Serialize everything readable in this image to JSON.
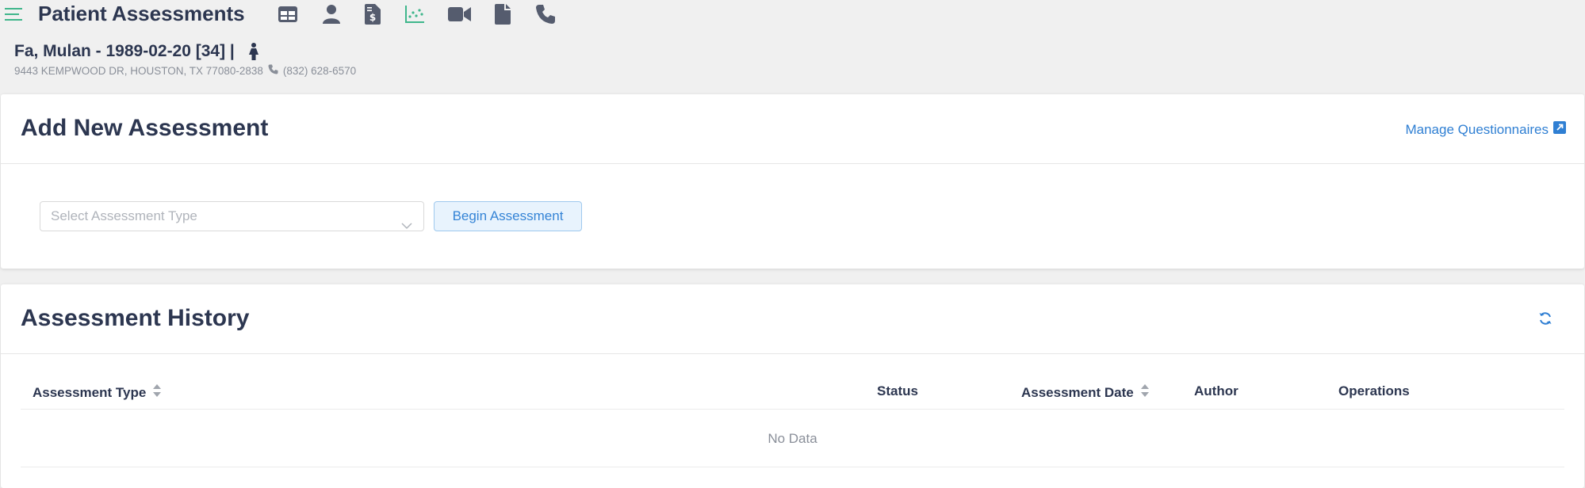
{
  "header": {
    "title": "Patient Assessments",
    "menu_icon": "hamburger-menu-icon",
    "nav_icons": [
      "table-icon",
      "person-icon",
      "billing-document-icon",
      "scatter-chart-icon",
      "video-icon",
      "file-icon",
      "phone-icon"
    ],
    "active_icon_color": "#3fb68b"
  },
  "patient": {
    "name_line": "Fa, Mulan - 1989-02-20 [34] |",
    "sex_icon": "female-icon",
    "address": "9443 KEMPWOOD DR, HOUSTON, TX 77080-2838",
    "phone": "(832) 628-6570"
  },
  "add_assessment": {
    "title": "Add New Assessment",
    "manage_link": "Manage Questionnaires",
    "select_placeholder": "Select Assessment Type",
    "begin_button": "Begin Assessment"
  },
  "history": {
    "title": "Assessment History",
    "columns": [
      "Assessment Type",
      "Status",
      "Assessment Date",
      "Author",
      "Operations"
    ],
    "empty_text": "No Data"
  },
  "colors": {
    "accent": "#2f7fd3",
    "title_text": "#2c3650",
    "background": "#f0f0f0"
  }
}
